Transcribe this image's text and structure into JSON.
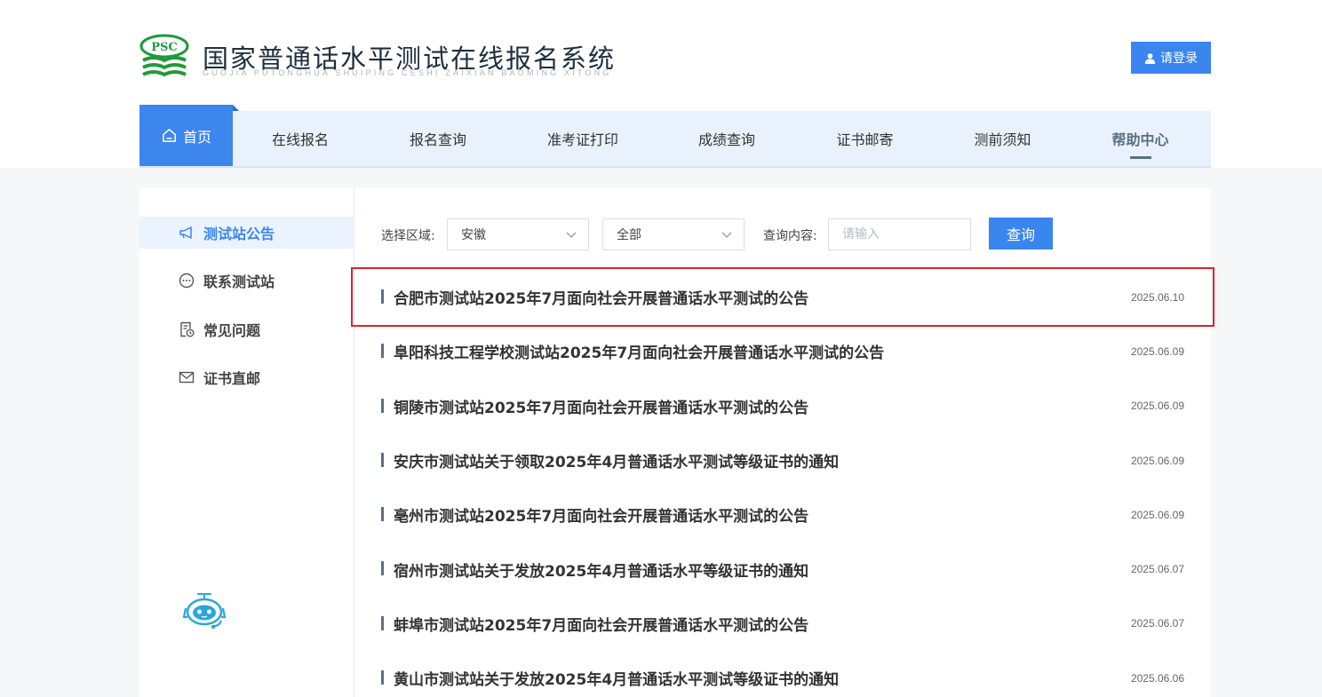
{
  "brand": {
    "logo_text": "PSC",
    "title": "国家普通话水平测试在线报名系统",
    "subtitle": "GUOJIA PUTONGHUA SHUIPING CESHI ZAIXIAN BAOMING XITONG"
  },
  "header": {
    "login_label": "请登录",
    "login_icon": "user-icon"
  },
  "nav": {
    "home_label": "首页",
    "home_icon": "home-icon",
    "items": [
      {
        "label": "在线报名"
      },
      {
        "label": "报名查询"
      },
      {
        "label": "准考证打印"
      },
      {
        "label": "成绩查询"
      },
      {
        "label": "证书邮寄"
      },
      {
        "label": "测前须知"
      },
      {
        "label": "帮助中心",
        "active": true
      }
    ]
  },
  "sidebar": {
    "items": [
      {
        "label": "测试站公告",
        "icon": "megaphone-icon",
        "active": true
      },
      {
        "label": "联系测试站",
        "icon": "chat-icon"
      },
      {
        "label": "常见问题",
        "icon": "document-clock-icon"
      },
      {
        "label": "证书直邮",
        "icon": "mail-icon"
      }
    ],
    "assistant_icon": "robot-assistant-icon"
  },
  "filters": {
    "region_label": "选择区域:",
    "region_value": "安徽",
    "category_value": "全部",
    "query_label": "查询内容:",
    "query_placeholder": "请输入",
    "query_button": "查询"
  },
  "announcements": [
    {
      "title": "合肥市测试站2025年7月面向社会开展普通话水平测试的公告",
      "date": "2025.06.10"
    },
    {
      "title": "阜阳科技工程学校测试站2025年7月面向社会开展普通话水平测试的公告",
      "date": "2025.06.09"
    },
    {
      "title": "铜陵市测试站2025年7月面向社会开展普通话水平测试的公告",
      "date": "2025.06.09"
    },
    {
      "title": "安庆市测试站关于领取2025年4月普通话水平测试等级证书的通知",
      "date": "2025.06.09"
    },
    {
      "title": "亳州市测试站2025年7月面向社会开展普通话水平测试的公告",
      "date": "2025.06.09"
    },
    {
      "title": "宿州市测试站关于发放2025年4月普通话水平等级证书的通知",
      "date": "2025.06.07"
    },
    {
      "title": "蚌埠市测试站2025年7月面向社会开展普通话水平测试的公告",
      "date": "2025.06.07"
    },
    {
      "title": "黄山市测试站关于发放2025年4月普通话水平测试等级证书的通知",
      "date": "2025.06.06"
    }
  ],
  "colors": {
    "accent": "#3a86ef",
    "nav_bg": "#e9f2fc",
    "highlight_border": "#d7262b",
    "logo_green": "#1f9a3a"
  }
}
